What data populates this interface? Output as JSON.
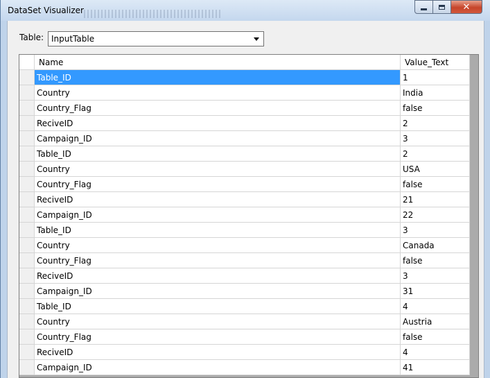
{
  "window": {
    "title": "DataSet Visualizer",
    "close_label": "✕"
  },
  "table_selector": {
    "label": "Table:",
    "selected": "InputTable"
  },
  "grid": {
    "columns": [
      "Name",
      "Value_Text"
    ],
    "selected_row": 0,
    "rows": [
      {
        "name": "Table_ID",
        "value": "1"
      },
      {
        "name": "Country",
        "value": "India"
      },
      {
        "name": "Country_Flag",
        "value": "false"
      },
      {
        "name": "ReciveID",
        "value": "2"
      },
      {
        "name": "Campaign_ID",
        "value": "3"
      },
      {
        "name": "Table_ID",
        "value": "2"
      },
      {
        "name": "Country",
        "value": "USA"
      },
      {
        "name": "Country_Flag",
        "value": "false"
      },
      {
        "name": "ReciveID",
        "value": "21"
      },
      {
        "name": "Campaign_ID",
        "value": "22"
      },
      {
        "name": "Table_ID",
        "value": "3"
      },
      {
        "name": "Country",
        "value": "Canada"
      },
      {
        "name": "Country_Flag",
        "value": "false"
      },
      {
        "name": "ReciveID",
        "value": "3"
      },
      {
        "name": "Campaign_ID",
        "value": "31"
      },
      {
        "name": "Table_ID",
        "value": "4"
      },
      {
        "name": "Country",
        "value": "Austria"
      },
      {
        "name": "Country_Flag",
        "value": "false"
      },
      {
        "name": "ReciveID",
        "value": "4"
      },
      {
        "name": "Campaign_ID",
        "value": "41"
      }
    ]
  },
  "colors": {
    "selection": "#3399ff",
    "close_button": "#c6452b"
  }
}
